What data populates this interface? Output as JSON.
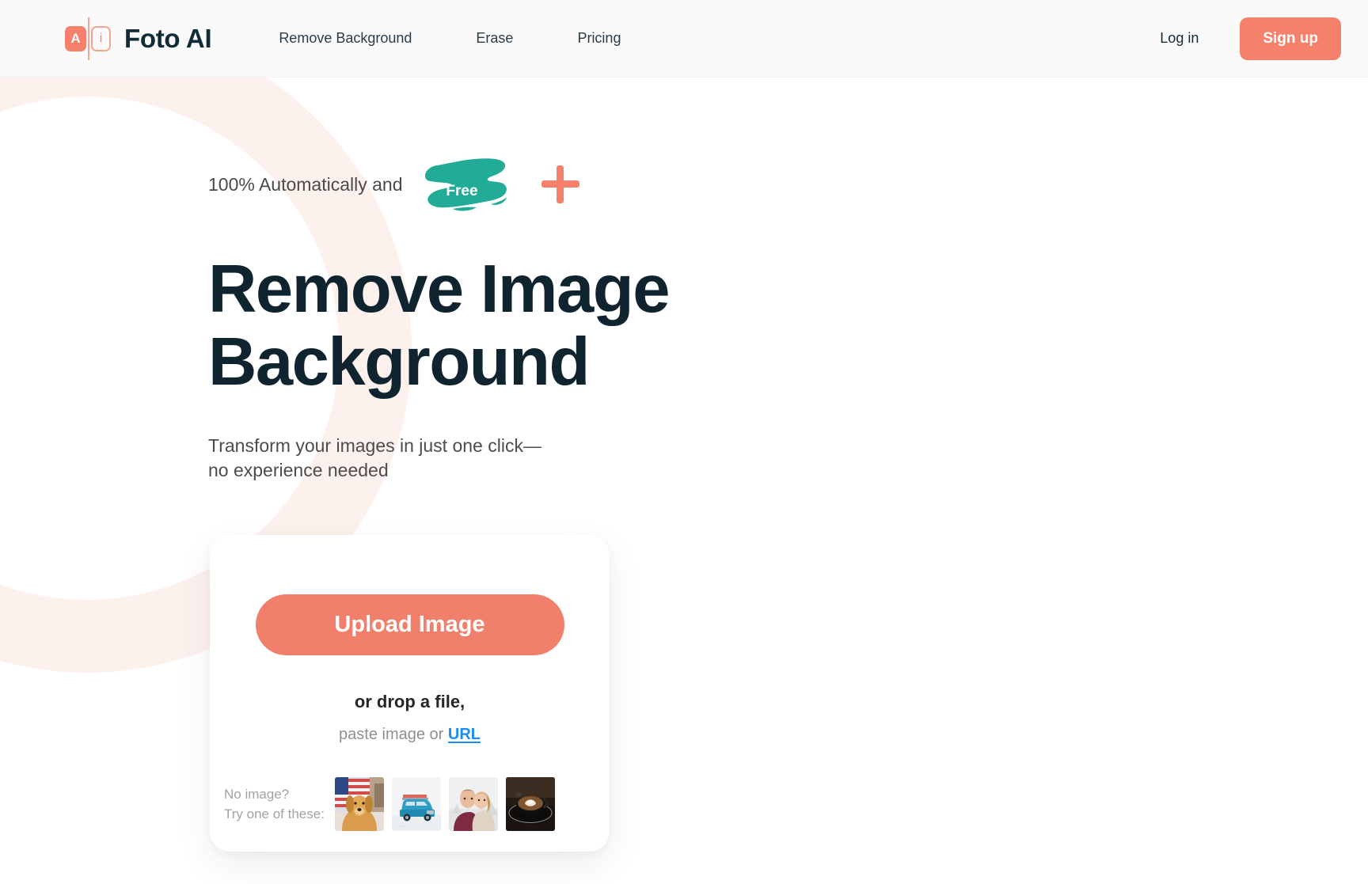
{
  "brand": {
    "name": "Foto AI",
    "logo_letter_a": "A",
    "logo_letter_i": "i",
    "accent_color": "#f5806b"
  },
  "header": {
    "nav": [
      {
        "label": "Remove Background",
        "name": "nav-remove-background"
      },
      {
        "label": "Erase",
        "name": "nav-erase"
      },
      {
        "label": "Pricing",
        "name": "nav-pricing"
      }
    ],
    "login_label": "Log in",
    "signup_label": "Sign up"
  },
  "hero": {
    "tagline": "100% Automatically and",
    "badge_label": "Free",
    "badge_color": "#22ab96",
    "plus_icon": "plus-icon",
    "title_line_1": "Remove Image",
    "title_line_2": "Background",
    "subtitle": "Transform your images in just one click—no experience needed",
    "title_color": "#10242f"
  },
  "upload_card": {
    "upload_button_label": "Upload Image",
    "drop_text": "or drop a file,",
    "paste_prefix": "paste image or ",
    "paste_link_label": "URL",
    "link_color": "#1b8ef2",
    "samples_label_line_1": "No image?",
    "samples_label_line_2": "Try one of these:",
    "samples": [
      {
        "name": "sample-thumb-dog",
        "alt": "Golden retriever in front of American flag"
      },
      {
        "name": "sample-thumb-car",
        "alt": "Blue vintage car with roof rack in snow"
      },
      {
        "name": "sample-thumb-couple",
        "alt": "Couple embracing in winter"
      },
      {
        "name": "sample-thumb-coffee",
        "alt": "Cup of coffee with latte art on saucer"
      }
    ]
  }
}
